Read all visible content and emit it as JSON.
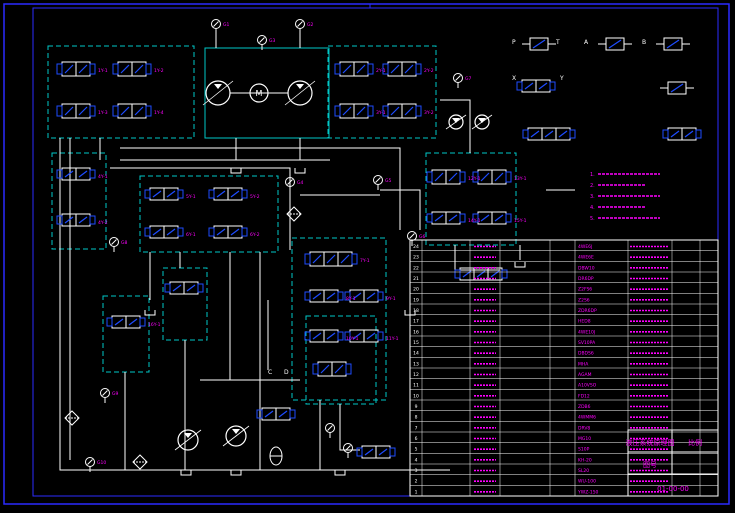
{
  "colors": {
    "background": "#000000",
    "frame": "#2b2bff",
    "line": "#ffffff",
    "box": "#00c8c8",
    "component": "#1e4cff",
    "label": "#ff00ff",
    "table_text": "#ff00ff",
    "accent": "#ffff00"
  },
  "drawing": {
    "drawing_no": "01-00-00",
    "title_block_rows": [
      "液压系统原理图",
      "比例",
      "图号"
    ]
  },
  "component_tags": [
    "1Y-1",
    "1Y-2",
    "1Y-3",
    "1Y-4",
    "2Y-1",
    "2Y-2",
    "3Y-1",
    "3Y-2",
    "4Y-1",
    "4Y-2",
    "5Y-1",
    "5Y-2",
    "6Y-1",
    "6Y-2",
    "7Y-1",
    "8Y-1",
    "9Y-1",
    "10Y-1",
    "11Y-1",
    "12Y-1",
    "13Y-1",
    "14Y-1",
    "15Y-1",
    "16Y-1"
  ],
  "gauge_tags": [
    "G1",
    "G2",
    "G3",
    "G4",
    "G5",
    "G6",
    "G7",
    "G8",
    "G9",
    "G10"
  ],
  "port_labels": [
    "P",
    "T",
    "A",
    "B",
    "X",
    "Y",
    "C",
    "D"
  ],
  "legend": {
    "symbols": [
      {
        "icon": "check-valve-icon"
      },
      {
        "icon": "throttle-valve-icon"
      },
      {
        "icon": "relief-valve-icon"
      },
      {
        "icon": "directional-valve-icon"
      }
    ],
    "notes": [
      "1.",
      "2.",
      "3.",
      "4.",
      "5."
    ]
  },
  "parts_table": {
    "rows": 24,
    "model_column": [
      "4WE6J",
      "4WE6E",
      "DBW10",
      "DR6DP",
      "Z2FS6",
      "Z2S6",
      "ZDR6DP",
      "HED8",
      "4WE10J",
      "SV10PA",
      "DBDS6",
      "MHA",
      "AGAM",
      "A10VSO",
      "FD12",
      "ZDB6",
      "4WMM6",
      "DRV8",
      "MG10",
      "S10P",
      "KH-20",
      "SL20",
      "WU-100",
      "YWZ-150"
    ]
  }
}
